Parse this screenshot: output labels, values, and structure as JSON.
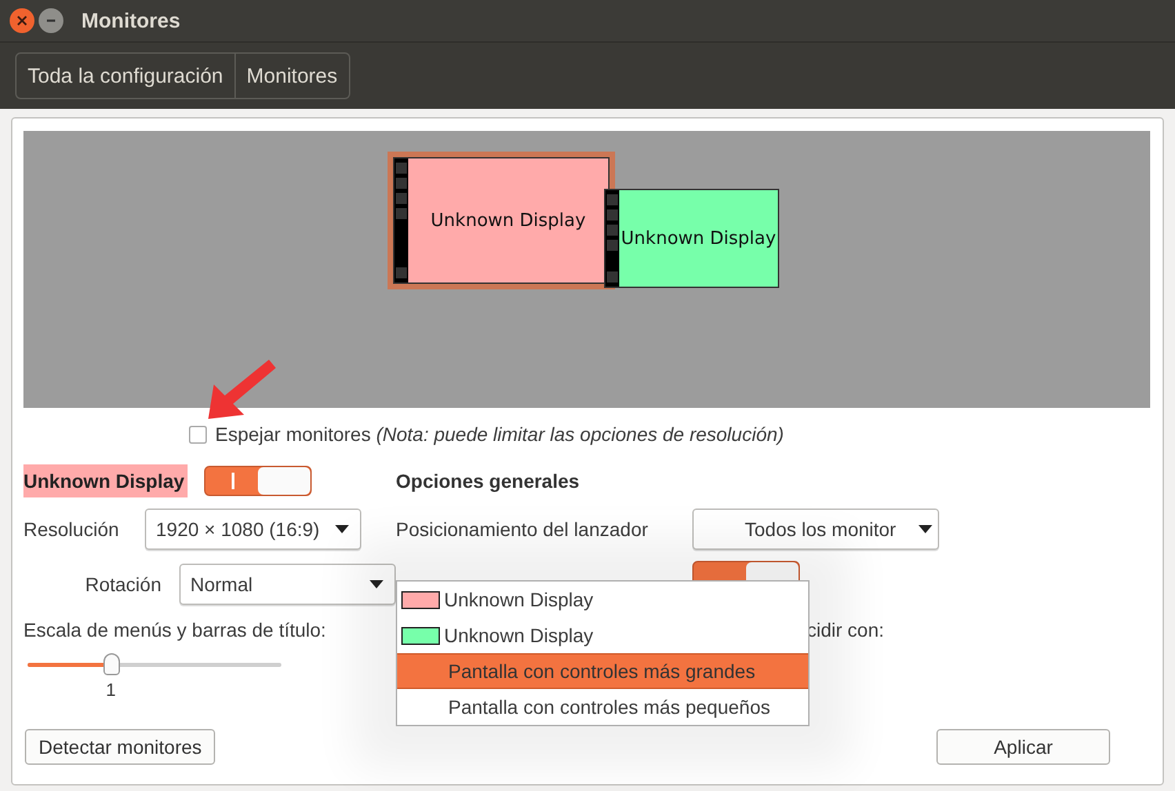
{
  "window": {
    "title": "Monitores"
  },
  "breadcrumbs": [
    {
      "label": "Toda la configuración"
    },
    {
      "label": "Monitores"
    }
  ],
  "displays": [
    {
      "label": "Unknown Display",
      "color": "#ffaaaa",
      "selected": true
    },
    {
      "label": "Unknown Display",
      "color": "#77ffaa",
      "selected": false
    }
  ],
  "mirror": {
    "label": "Espejar monitores",
    "note": "(Nota: puede limitar las opciones de resolución)",
    "checked": false
  },
  "display_settings": {
    "name": "Unknown Display",
    "on": true,
    "resolution_label": "Resolución",
    "resolution": "1920 × 1080 (16:9)",
    "rotation_label": "Rotación",
    "rotation": "Normal",
    "scale_label": "Escala de menús y barras de título:",
    "scale": {
      "level": 0.33,
      "reading": "1"
    }
  },
  "general": {
    "title": "Opciones generales",
    "launcher_label": "Posicionamiento del lanzador",
    "launcher": "Todos los monitor",
    "toggle_on": true,
    "partial_label": "cidir con:"
  },
  "menu": {
    "items": [
      {
        "label": "Unknown Display",
        "color": "#ffaaaa",
        "selected": false
      },
      {
        "label": "Unknown Display",
        "color": "#77ffaa",
        "selected": false
      },
      {
        "label": "Pantalla con controles más grandes",
        "selected": true
      },
      {
        "label": "Pantalla con controles más pequeños",
        "selected": false
      }
    ]
  },
  "buttons": [
    {
      "label": "Detectar monitores"
    },
    {
      "label": "Aplicar"
    }
  ]
}
